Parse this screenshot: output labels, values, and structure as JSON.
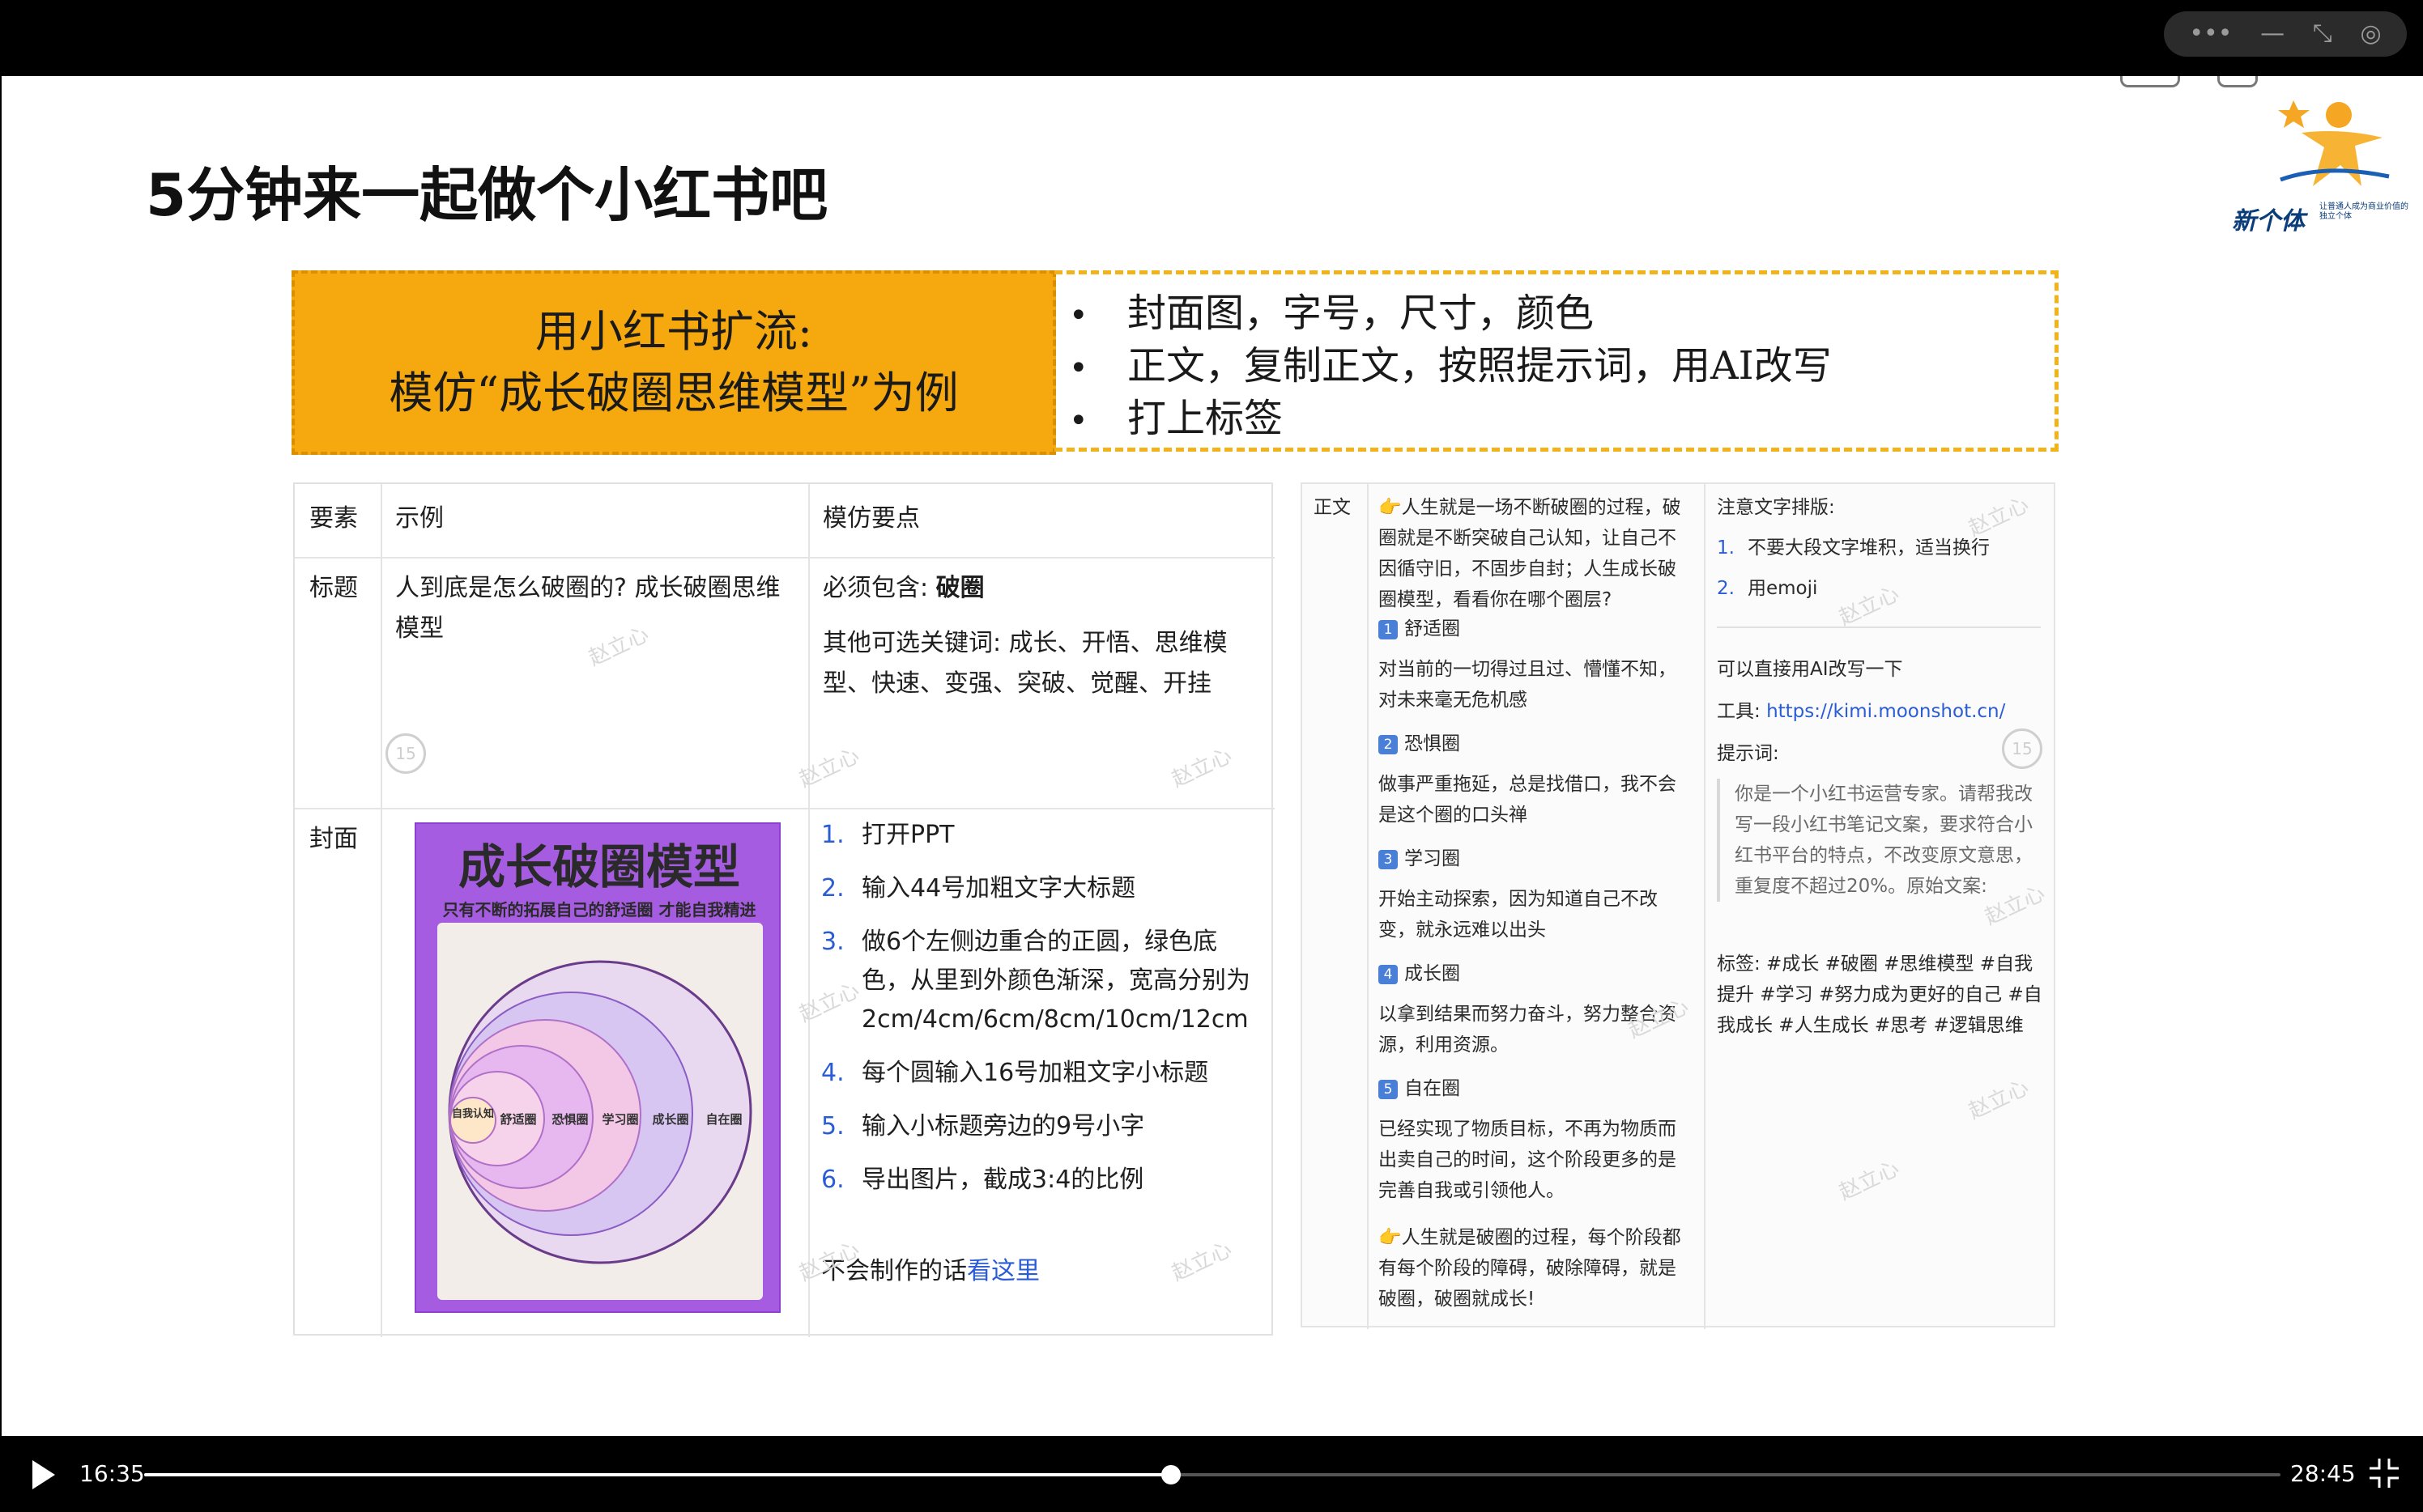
{
  "window": {
    "controls": [
      "•••",
      "—",
      "⤡",
      "◎"
    ]
  },
  "slide": {
    "title": "5分钟来一起做个小红书吧",
    "logo": {
      "text": "新个体",
      "sub": "让普通人成为商业价值的独立个体"
    },
    "banner": {
      "left_line1": "用小红书扩流:",
      "left_line2": "模仿“成长破圈思维模型”为例",
      "bullets": [
        "封面图，字号，尺寸，颜色",
        "正文，复制正文，按照提示词，用AI改写",
        "打上标签"
      ]
    },
    "left_table": {
      "headers": [
        "要素",
        "示例",
        "模仿要点"
      ],
      "row_title": {
        "label": "标题",
        "example": "人到底是怎么破圈的? 成长破圈思维模型",
        "must_prefix": "必须包含: ",
        "must_keyword": "破圈",
        "optional": "其他可选关键词: 成长、开悟、思维模型、快速、变强、突破、觉醒、开挂"
      },
      "row_cover": {
        "label": "封面",
        "cover_title": "成长破圈模型",
        "cover_sub": "只有不断的拓展自己的舒适圈 才能自我精进",
        "circle_labels": [
          "自我认知",
          "舒适圈",
          "恐惧圈",
          "学习圈",
          "成长圈",
          "自在圈"
        ],
        "steps": [
          {
            "n": "1.",
            "t": "打开PPT"
          },
          {
            "n": "2.",
            "t": "输入44号加粗文字大标题"
          },
          {
            "n": "3.",
            "t": "做6个左侧边重合的正圆，绿色底色，从里到外颜色渐深，宽高分别为2cm/4cm/6cm/8cm/10cm/12cm"
          },
          {
            "n": "4.",
            "t": "每个圆输入16号加粗文字小标题"
          },
          {
            "n": "5.",
            "t": "输入小标题旁边的9号小字"
          },
          {
            "n": "6.",
            "t": "导出图片，截成3:4的比例"
          }
        ],
        "footer_prefix": "不会制作的话",
        "footer_link": "看这里"
      }
    },
    "right_panel": {
      "label": "正文",
      "body_intro": "👉人生就是一场不断破圈的过程，破圈就是不断突破自己认知，让自己不因循守旧，不固步自封；人生成长破圈模型，看看你在哪个圈层?",
      "sections": [
        {
          "num": "1",
          "title": "舒适圈",
          "text": "对当前的一切得过且过、懵懂不知，对未来毫无危机感"
        },
        {
          "num": "2",
          "title": "恐惧圈",
          "text": "做事严重拖延，总是找借口，我不会是这个圈的口头禅"
        },
        {
          "num": "3",
          "title": "学习圈",
          "text": "开始主动探索，因为知道自己不改变，就永远难以出头"
        },
        {
          "num": "4",
          "title": "成长圈",
          "text": "以拿到结果而努力奋斗，努力整合资源，利用资源。"
        },
        {
          "num": "5",
          "title": "自在圈",
          "text": "已经实现了物质目标，不再为物质而出卖自己的时间，这个阶段更多的是完善自我或引领他人。"
        }
      ],
      "body_outro": "👉人生就是破圈的过程，每个阶段都有每个阶段的障碍，破除障碍，就是破圈，破圈就成长!",
      "notes_title": "注意文字排版:",
      "notes": [
        {
          "n": "1.",
          "t": "不要大段文字堆积，适当换行"
        },
        {
          "n": "2.",
          "t": "用emoji"
        }
      ],
      "ai_line": "可以直接用AI改写一下",
      "tool_prefix": "工具: ",
      "tool_url": "https://kimi.moonshot.cn/",
      "prompt_label": "提示词:",
      "prompt_quote": "你是一个小红书运营专家。请帮我改写一段小红书笔记文案，要求符合小红书平台的特点，不改变原文意思，重复度不超过20%。原始文案:",
      "tags": "标签: #成长 #破圈 #思维模型 #自我提升 #学习 #努力成为更好的自己 #自我成长 #人生成长 #思考 #逻辑思维"
    },
    "watermark": "赵立心",
    "replay_badge": "15"
  },
  "player": {
    "current_time": "16:35",
    "duration": "28:45",
    "progress": 0.4807
  }
}
